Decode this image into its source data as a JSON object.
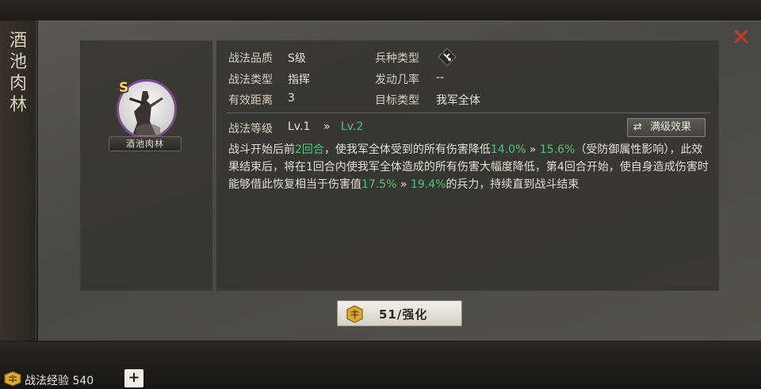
{
  "title": "酒池肉林",
  "name_tag": "酒池肉林",
  "grade_badge": "S",
  "close_label": "✕",
  "attrs": {
    "quality_label": "战法品质",
    "quality_value": "S级",
    "troop_label": "兵种类型",
    "type_label": "战法类型",
    "type_value": "指挥",
    "rate_label": "发动几率",
    "rate_value": "--",
    "range_label": "有效距离",
    "range_value": "3",
    "target_label": "目标类型",
    "target_value": "我军全体"
  },
  "level": {
    "label": "战法等级",
    "current": "Lv.1",
    "arrow": "»",
    "next": "Lv.2"
  },
  "max_effect_button": "满级效果",
  "description": {
    "p1": "战斗开始后前",
    "rounds": "2回合",
    "p2": "，使我军全体受到的所有伤害降低",
    "dmg_from": "14.0%",
    "arrow1": " » ",
    "dmg_to": "15.6%",
    "p3": "（受防御属性影响），此效果结束后，将在1回合内使我军全体造成的所有伤害大幅度降低，第4回合开始，使自身造成伤害时能够借此恢复相当于伤害值",
    "heal_from": "17.5%",
    "arrow2": " » ",
    "heal_to": "19.4%",
    "p4": "的兵力，持续直到战斗结束"
  },
  "enhance_button": "51/强化",
  "footer": {
    "exp_label": "战法经验 540",
    "plus": "+"
  },
  "colors": {
    "accent_green": "#4fc47a",
    "close_red": "#c9392e",
    "portrait_ring": "#7c4a8f"
  }
}
